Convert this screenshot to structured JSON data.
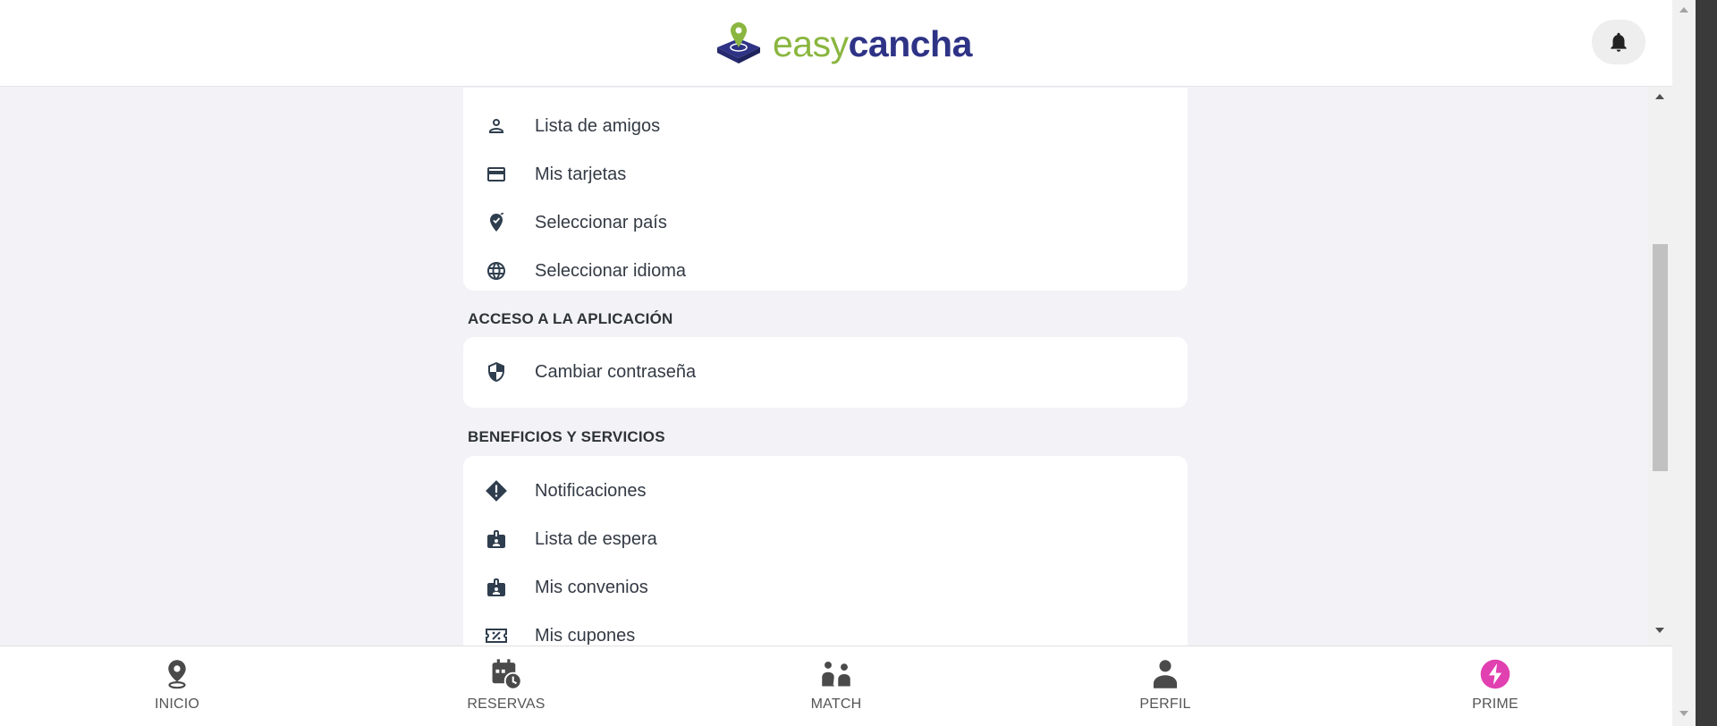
{
  "header": {
    "logo_easy": "easy",
    "logo_cancha": "cancha",
    "brand_colors": {
      "green": "#8ab63f",
      "navy": "#2e3386"
    }
  },
  "sections": [
    {
      "title": "",
      "items": [
        {
          "label": "Lista de amigos",
          "icon": "person-icon"
        },
        {
          "label": "Mis tarjetas",
          "icon": "credit-card-icon"
        },
        {
          "label": "Seleccionar país",
          "icon": "location-check-icon"
        },
        {
          "label": "Seleccionar idioma",
          "icon": "globe-icon"
        }
      ]
    },
    {
      "title": "ACCESO A LA APLICACIÓN",
      "items": [
        {
          "label": "Cambiar contraseña",
          "icon": "shield-icon"
        }
      ]
    },
    {
      "title": "BENEFICIOS Y SERVICIOS",
      "items": [
        {
          "label": "Notificaciones",
          "icon": "warning-diamond-icon"
        },
        {
          "label": "Lista de espera",
          "icon": "badge-icon"
        },
        {
          "label": "Mis convenios",
          "icon": "badge-icon"
        },
        {
          "label": "Mis cupones",
          "icon": "coupon-icon"
        }
      ]
    }
  ],
  "bottom_nav": [
    {
      "label": "INICIO",
      "icon": "location-pin-icon"
    },
    {
      "label": "RESERVAS",
      "icon": "calendar-clock-icon"
    },
    {
      "label": "MATCH",
      "icon": "players-icon"
    },
    {
      "label": "PERFIL",
      "icon": "person-icon"
    },
    {
      "label": "PRIME",
      "icon": "lightning-icon",
      "color": "#e040b0"
    }
  ]
}
